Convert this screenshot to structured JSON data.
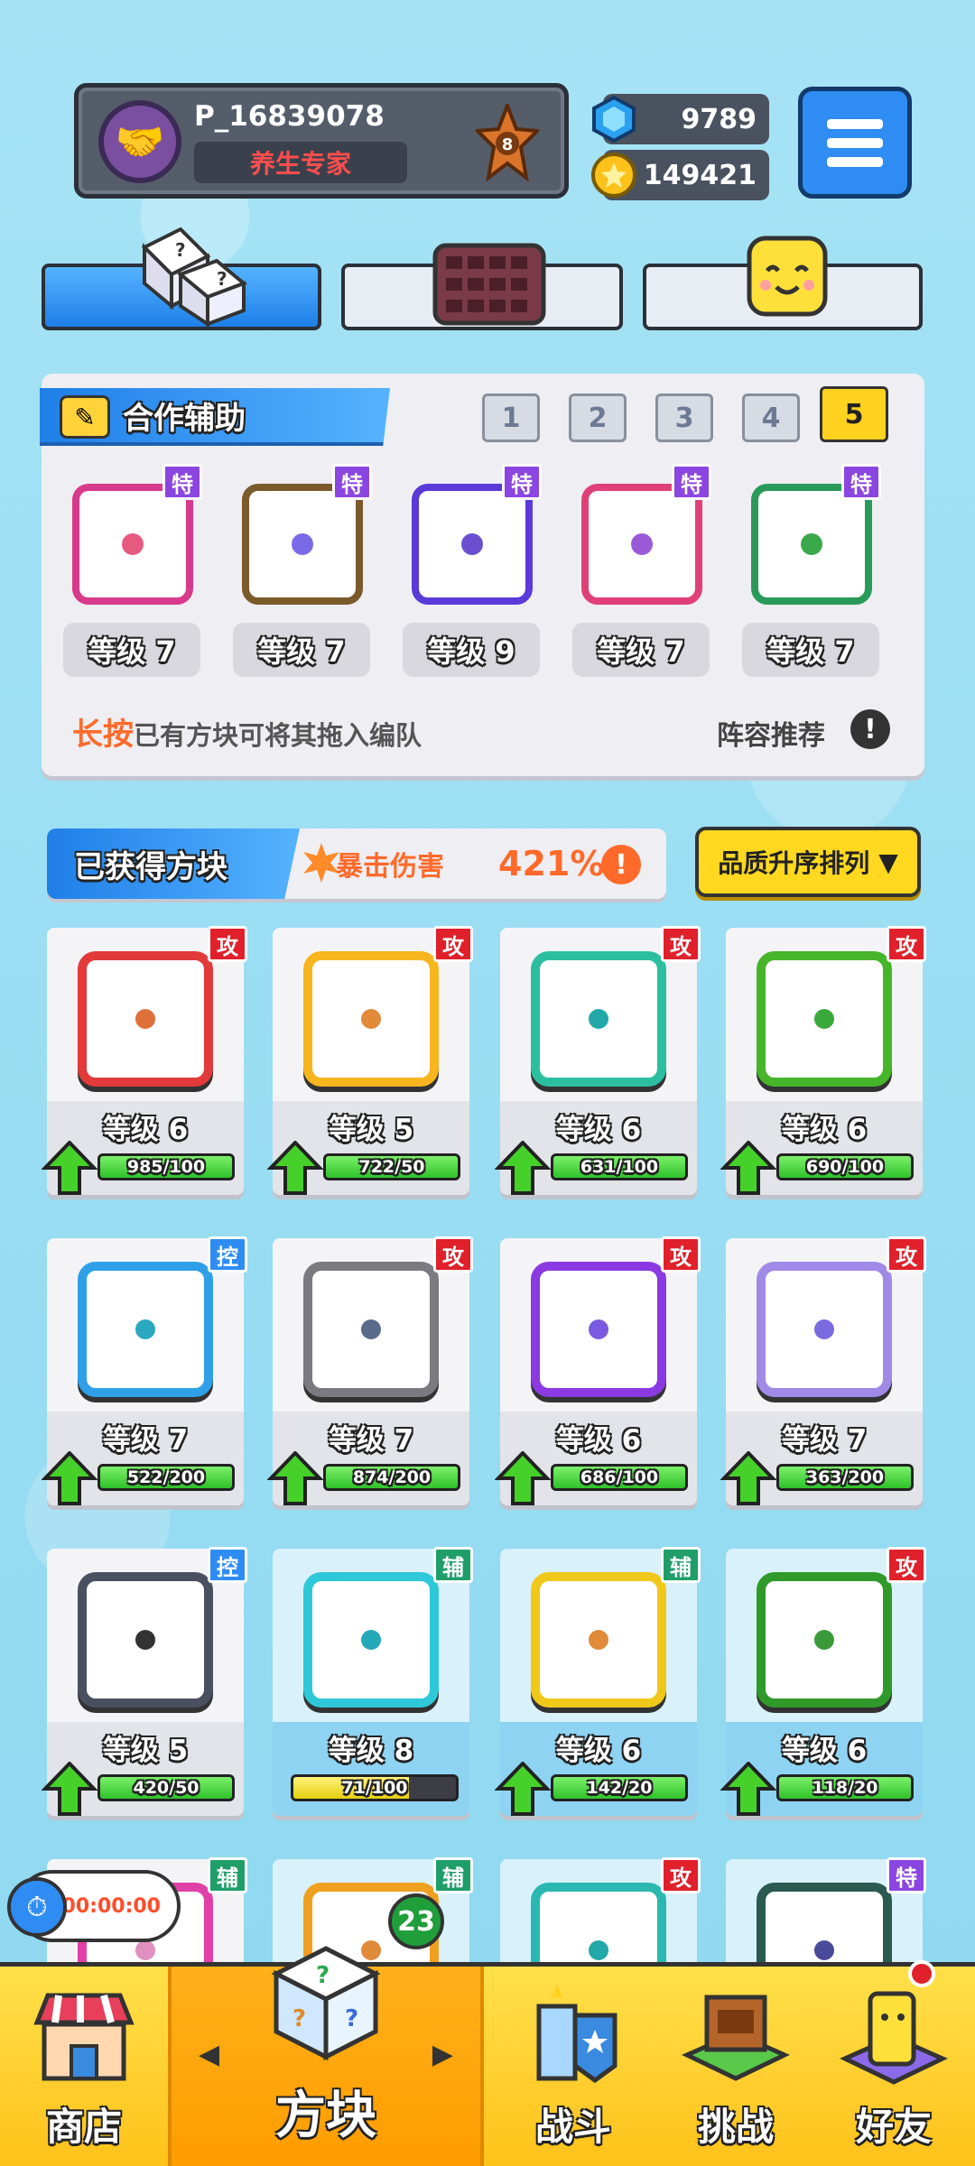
{
  "player": {
    "name": "P_16839078",
    "title": "养生专家",
    "rank": "8"
  },
  "currency": {
    "gems": "9789",
    "coins": "149421"
  },
  "team": {
    "label": "合作辅助",
    "slots": [
      "1",
      "2",
      "3",
      "4",
      "5"
    ],
    "active_slot": "5",
    "members": [
      {
        "badge": "特",
        "level": "等级 7",
        "color": "#d83a8c",
        "dot": "#e65a82",
        "badge_color": "#8b45e0"
      },
      {
        "badge": "特",
        "level": "等级 7",
        "color": "#7a5a2a",
        "dot": "#7b6ae8",
        "badge_color": "#8b45e0"
      },
      {
        "badge": "特",
        "level": "等级 9",
        "color": "#5a3ad8",
        "dot": "#6a50d0",
        "badge_color": "#8b45e0"
      },
      {
        "badge": "特",
        "level": "等级 7",
        "color": "#e0407a",
        "dot": "#9a5ad8",
        "badge_color": "#8b45e0"
      },
      {
        "badge": "特",
        "level": "等级 7",
        "color": "#2a9a5a",
        "dot": "#3aa84a",
        "badge_color": "#8b45e0"
      }
    ],
    "hint_bold": "长按",
    "hint_rest": "已有方块可将其拖入编队",
    "lineup": "阵容推荐"
  },
  "owned": {
    "title": "已获得方块",
    "crit_label": "暴击伤害",
    "crit_value": "421%",
    "sort": "品质升序排列"
  },
  "dice": [
    {
      "badge": "攻",
      "badge_color": "#e0202a",
      "level": "等级 6",
      "progress": "985/100",
      "pct": 100,
      "color": "#e23a3a",
      "dot": "#e0703a",
      "blue": false,
      "can_upgrade": true
    },
    {
      "badge": "攻",
      "badge_color": "#e0202a",
      "level": "等级 5",
      "progress": "722/50",
      "pct": 100,
      "color": "#f7b51e",
      "dot": "#e08a3a",
      "blue": false,
      "can_upgrade": true
    },
    {
      "badge": "攻",
      "badge_color": "#e0202a",
      "level": "等级 6",
      "progress": "631/100",
      "pct": 100,
      "color": "#2bbfa0",
      "dot": "#22a8a8",
      "blue": false,
      "can_upgrade": true
    },
    {
      "badge": "攻",
      "badge_color": "#e0202a",
      "level": "等级 6",
      "progress": "690/100",
      "pct": 100,
      "color": "#46b52a",
      "dot": "#3aa83a",
      "blue": false,
      "can_upgrade": true
    },
    {
      "badge": "控",
      "badge_color": "#2f8cf3",
      "level": "等级 7",
      "progress": "522/200",
      "pct": 100,
      "color": "#2fa0e8",
      "dot": "#2aa8c0",
      "blue": false,
      "can_upgrade": true
    },
    {
      "badge": "攻",
      "badge_color": "#e0202a",
      "level": "等级 7",
      "progress": "874/200",
      "pct": 100,
      "color": "#7a7a80",
      "dot": "#5a6a8a",
      "blue": false,
      "can_upgrade": true
    },
    {
      "badge": "攻",
      "badge_color": "#e0202a",
      "level": "等级 6",
      "progress": "686/100",
      "pct": 100,
      "color": "#8a3ae0",
      "dot": "#7a5ae0",
      "blue": false,
      "can_upgrade": true
    },
    {
      "badge": "攻",
      "badge_color": "#e0202a",
      "level": "等级 7",
      "progress": "363/200",
      "pct": 100,
      "color": "#a08ae8",
      "dot": "#7a6ae0",
      "blue": false,
      "can_upgrade": true
    },
    {
      "badge": "控",
      "badge_color": "#2f8cf3",
      "level": "等级 5",
      "progress": "420/50",
      "pct": 100,
      "color": "#4a5060",
      "dot": "#333",
      "blue": false,
      "can_upgrade": true
    },
    {
      "badge": "辅",
      "badge_color": "#1f9e6a",
      "level": "等级 8",
      "progress": "71/100",
      "pct": 71,
      "color": "#2fc8d8",
      "dot": "#22a8b8",
      "blue": true,
      "can_upgrade": false
    },
    {
      "badge": "辅",
      "badge_color": "#1f9e6a",
      "level": "等级 6",
      "progress": "142/20",
      "pct": 100,
      "color": "#f0c81a",
      "dot": "#e08a3a",
      "blue": true,
      "can_upgrade": true
    },
    {
      "badge": "攻",
      "badge_color": "#e0202a",
      "level": "等级 6",
      "progress": "118/20",
      "pct": 100,
      "color": "#2f9a2a",
      "dot": "#3a9a3a",
      "blue": true,
      "can_upgrade": true
    },
    {
      "badge": "辅",
      "badge_color": "#1f9e6a",
      "level": "",
      "progress": "",
      "pct": 0,
      "color": "#e040a8",
      "dot": "#e090c0",
      "blue": false,
      "can_upgrade": false
    },
    {
      "badge": "辅",
      "badge_color": "#1f9e6a",
      "level": "",
      "progress": "",
      "pct": 0,
      "color": "#f0a020",
      "dot": "#e08a3a",
      "blue": true,
      "can_upgrade": false
    },
    {
      "badge": "攻",
      "badge_color": "#e0202a",
      "level": "",
      "progress": "",
      "pct": 0,
      "color": "#2ab8b0",
      "dot": "#22a8a8",
      "blue": true,
      "can_upgrade": false
    },
    {
      "badge": "特",
      "badge_color": "#8b45e0",
      "level": "",
      "progress": "",
      "pct": 0,
      "color": "#2a5a50",
      "dot": "#4a4a9a",
      "blue": true,
      "can_upgrade": false
    }
  ],
  "timer": "00:00:00",
  "dice_count": "23",
  "nav": {
    "shop": "商店",
    "dice": "方块",
    "battle": "战斗",
    "challenge": "挑战",
    "friends": "好友"
  },
  "colors": {
    "accent_blue": "#2f8cf3",
    "nav_yellow": "#ffc21a",
    "progress_green": "#3ad33a",
    "progress_yellow": "#f7e41a"
  }
}
